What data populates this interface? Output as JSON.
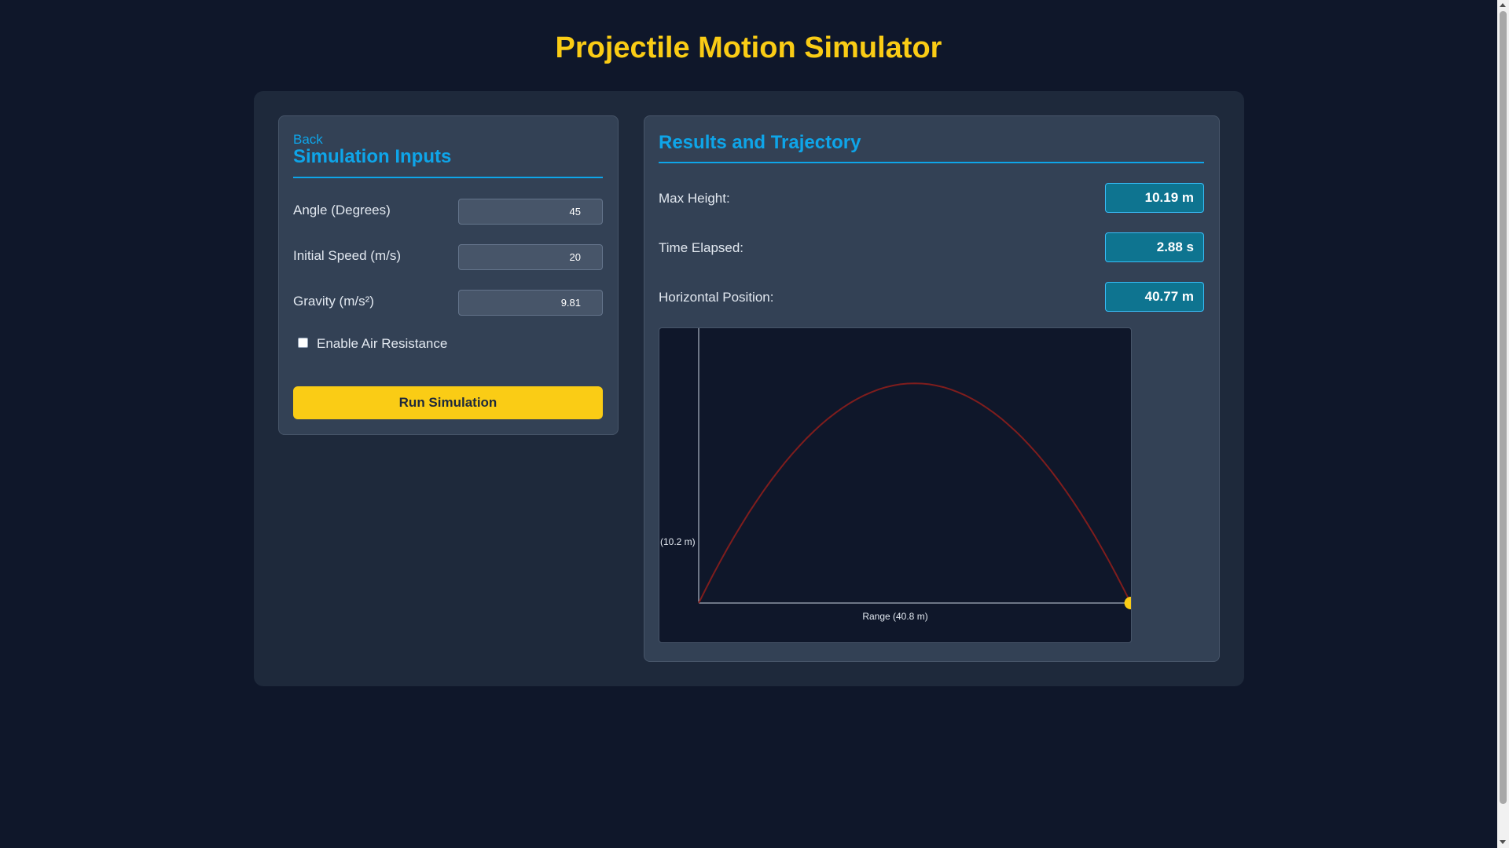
{
  "page": {
    "title": "Projectile Motion Simulator"
  },
  "inputs": {
    "back_label": "Back",
    "heading": "Simulation Inputs",
    "angle": {
      "label": "Angle (Degrees)",
      "value": "45"
    },
    "speed": {
      "label": "Initial Speed (m/s)",
      "value": "20"
    },
    "gravity": {
      "label": "Gravity (m/s²)",
      "value": "9.81"
    },
    "air_resistance": {
      "label": "Enable Air Resistance",
      "checked": false
    },
    "run_label": "Run Simulation"
  },
  "results": {
    "heading": "Results and Trajectory",
    "max_height": {
      "label": "Max Height:",
      "value": "10.19 m"
    },
    "time_elapsed": {
      "label": "Time Elapsed:",
      "value": "2.88 s"
    },
    "horizontal_position": {
      "label": "Horizontal Position:",
      "value": "40.77 m"
    }
  },
  "chart_data": {
    "type": "line",
    "y_axis_label": "(10.2 m)",
    "x_axis_label": "Range (40.8 m)",
    "angle_deg": 45,
    "speed_mps": 20,
    "gravity": 9.81,
    "xlim": [
      0,
      40.8
    ],
    "ylim": [
      0,
      10.2
    ],
    "projectile_position": {
      "x": 40.77,
      "y": 0
    },
    "colors": {
      "trajectory": "#7f1d1d",
      "projectile": "#facc15",
      "axes": "#cbd5e1"
    }
  },
  "colors": {
    "accent": "#0ea5e9",
    "title": "#facc15",
    "button": "#facc15",
    "value_box": "#0e7490"
  }
}
